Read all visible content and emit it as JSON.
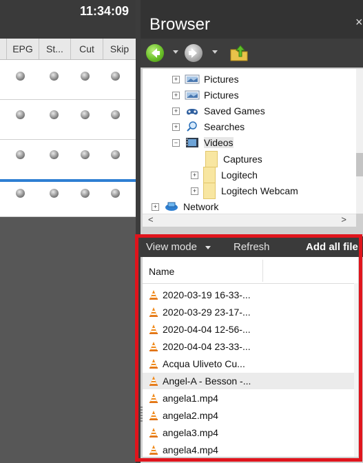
{
  "scheduler": {
    "clock": "11:34:09",
    "columns": [
      "EPG",
      "St...",
      "Cut",
      "Skip"
    ]
  },
  "browser": {
    "title": "Browser",
    "close_glyph": "×",
    "nav": {
      "back_icon": "back-arrow-icon",
      "forward_icon": "forward-arrow-icon",
      "up_icon": "folder-up-icon"
    },
    "tree": [
      {
        "label": "Pictures",
        "expander": "+",
        "icon": "pictures-icon"
      },
      {
        "label": "Pictures",
        "expander": "+",
        "icon": "pictures-icon"
      },
      {
        "label": "Saved Games",
        "expander": "+",
        "icon": "saved-games-icon"
      },
      {
        "label": "Searches",
        "expander": "+",
        "icon": "search-icon"
      },
      {
        "label": "Videos",
        "expander": "−",
        "icon": "videos-icon",
        "selected": true
      },
      {
        "label": "Captures",
        "expander": "",
        "icon": "folder-icon"
      },
      {
        "label": "Logitech",
        "expander": "+",
        "icon": "folder-icon"
      },
      {
        "label": "Logitech Webcam",
        "expander": "+",
        "icon": "folder-icon"
      },
      {
        "label": "Network",
        "expander": "+",
        "icon": "network-icon"
      }
    ],
    "scroll_left": "<",
    "scroll_right": ">",
    "toolbar": {
      "view_mode": "View mode",
      "refresh": "Refresh",
      "add_all": "Add all file"
    },
    "file_list": {
      "column": "Name",
      "files": [
        "2020-03-19 16-33-...",
        "2020-03-29 23-17-...",
        "2020-04-04 12-56-...",
        "2020-04-04 23-33-...",
        "Acqua Uliveto Cu...",
        "Angel-A - Besson -...",
        "angela1.mp4",
        "angela2.mp4",
        "angela3.mp4",
        "angela4.mp4"
      ],
      "selected_index": 5
    },
    "highlight_color": "#e0141c"
  }
}
